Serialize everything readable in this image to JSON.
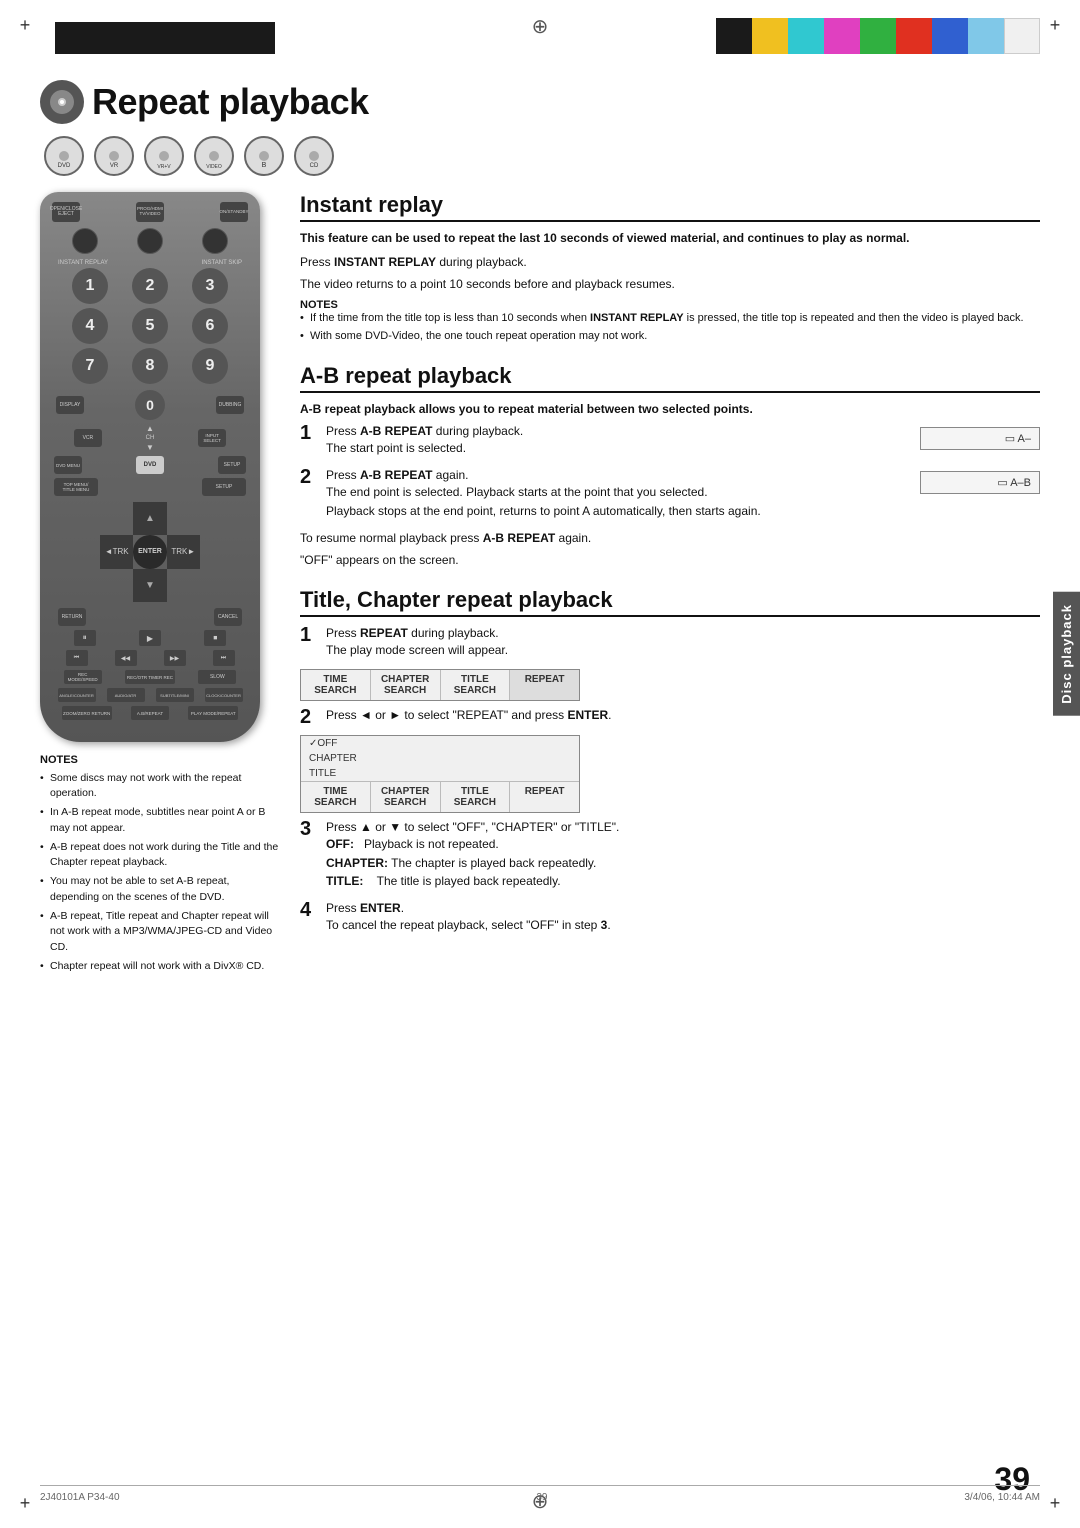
{
  "page": {
    "title": "Repeat playback",
    "number": "39",
    "footer_left": "2J40101A P34-40",
    "footer_center": "39",
    "footer_right": "3/4/06, 10:44 AM"
  },
  "color_bar": {
    "colors": [
      "black",
      "yellow",
      "cyan",
      "magenta",
      "green",
      "red",
      "blue",
      "ltblue",
      "white"
    ]
  },
  "icon_row": {
    "discs": [
      "DVD",
      "VR",
      "VR+VIDEO",
      "VIDEO",
      "B",
      "CD"
    ]
  },
  "sections": {
    "instant_replay": {
      "title": "Instant replay",
      "subtitle": "This feature can be used to repeat the last 10 seconds of viewed material, and continues to play as normal.",
      "step1": "Press INSTANT REPLAY during playback.",
      "step1_detail": "The video returns to a point 10 seconds before and playback resumes.",
      "notes_title": "NOTES",
      "notes": [
        "If the time from the title top is less than 10 seconds when INSTANT REPLAY is pressed, the title top is repeated and then the video is played back.",
        "With some DVD-Video, the one touch repeat operation may not work."
      ]
    },
    "ab_repeat": {
      "title": "A-B repeat playback",
      "subtitle": "A-B repeat playback allows you to repeat material between two selected points.",
      "step1_label": "1",
      "step1_text": "Press A-B REPEAT during playback.",
      "step1_detail": "The start point is selected.",
      "step1_screen": "⬜ A–",
      "step2_label": "2",
      "step2_text": "Press A-B REPEAT again.",
      "step2_detail1": "The end point is selected. Playback starts at the point that you selected.",
      "step2_detail2": "Playback stops at the end point, returns to point A automatically, then starts again.",
      "step2_screen": "⬜ A–B",
      "step3_text": "To resume normal playback press A-B REPEAT again.",
      "step3_detail": "\"OFF\" appears on the screen."
    },
    "title_chapter": {
      "title": "Title, Chapter repeat playback",
      "step1_label": "1",
      "step1_text": "Press REPEAT during playback.",
      "step1_detail": "The play mode screen will appear.",
      "screen1": {
        "cells": [
          "TIME\nSEARCH",
          "CHAPTER\nSEARCH",
          "TITLE\nSEARCH",
          "REPEAT"
        ]
      },
      "step2_label": "2",
      "step2_text": "Press ◄ or ► to select \"REPEAT\" and press ENTER.",
      "screen2": {
        "dropdown_items": [
          "✓OFF",
          "CHAPTER",
          "TITLE"
        ],
        "cells": [
          "TIME\nSEARCH",
          "CHAPTER\nSEARCH",
          "TITLE\nSEARCH",
          "REPEAT"
        ]
      },
      "step3_label": "3",
      "step3_text": "Press ▲ or ▼ to select \"OFF\", \"CHAPTER\" or \"TITLE\".",
      "step3_off": "OFF:",
      "step3_off_detail": "Playback is not repeated.",
      "step3_chapter": "CHAPTER:",
      "step3_chapter_detail": "The chapter is played back repeatedly.",
      "step3_title": "TITLE:",
      "step3_title_detail": "The title is played back repeatedly.",
      "step4_label": "4",
      "step4_text": "Press ENTER.",
      "step4_detail": "To cancel the repeat playback, select \"OFF\" in step 3."
    }
  },
  "left_notes": {
    "title": "NOTES",
    "items": [
      "Some discs may not work with the repeat operation.",
      "In A-B repeat mode, subtitles near point A or B may not appear.",
      "A-B repeat does not work during the Title and the Chapter repeat playback.",
      "You may not be able to set A-B repeat, depending on the scenes of the DVD.",
      "A-B repeat, Title repeat and Chapter repeat will not work with a MP3/WMA/JPEG-CD and Video CD.",
      "Chapter repeat will not work with a DivX® CD."
    ]
  },
  "side_tab": {
    "label": "Disc playback"
  },
  "remote": {
    "numbers": [
      "1",
      "2",
      "3",
      "4",
      "5",
      "6",
      "7",
      "8",
      "9",
      "0"
    ],
    "labels": {
      "open_close": "OPEN/CLOSE\nEJECT",
      "prog_hdmi": "PROG/HDMI TV/VIDEO",
      "on_standby": "ON/STANDBY",
      "instant_replay": "INSTANT REPLAY",
      "instant_skip": "INSTANT SKIP",
      "display": "DISPLAY",
      "dubbing": "DUBBING",
      "vcr": "VCR",
      "ch": "CH",
      "input_select": "INPUT SELECT",
      "dvd_menu": "DVD MENU",
      "dvd": "DVD",
      "top_menu_title_menu": "TOP MENU/\nTITLE MENU",
      "setup": "SETUP",
      "enter": "ENTER",
      "return": "RETURN",
      "cancel": "CANCEL",
      "pause_still": "PAUSE/STILL",
      "play": "PLAY",
      "stop": "STOP",
      "skip_index_rew": "SKIP/\nINDEX\nREW",
      "search_rew": "SEARCH/\nREW",
      "search_ffwd": "SEARCH/\nF.FWD",
      "skip_index": "SKIP/\nINDEX",
      "rec_mode_speed": "REC MODE/\nSPEED",
      "rec_otr": "REC/OTR TIMER REC",
      "slow": "SLOW",
      "angle": "ANGLE/\nCOUNTER",
      "audio_atm": "AUDIO/\nATR",
      "subtitle_mini": "SUBTITLE/\nMINI",
      "clock_counter": "CLOCK/\nCOUNTER",
      "zoom": "ZOOM/\nZERO RETURN",
      "ab_repeat": "A.B/REPEAT",
      "play_mode_repeat": "PLAY MODE/\nREPEAT"
    }
  }
}
